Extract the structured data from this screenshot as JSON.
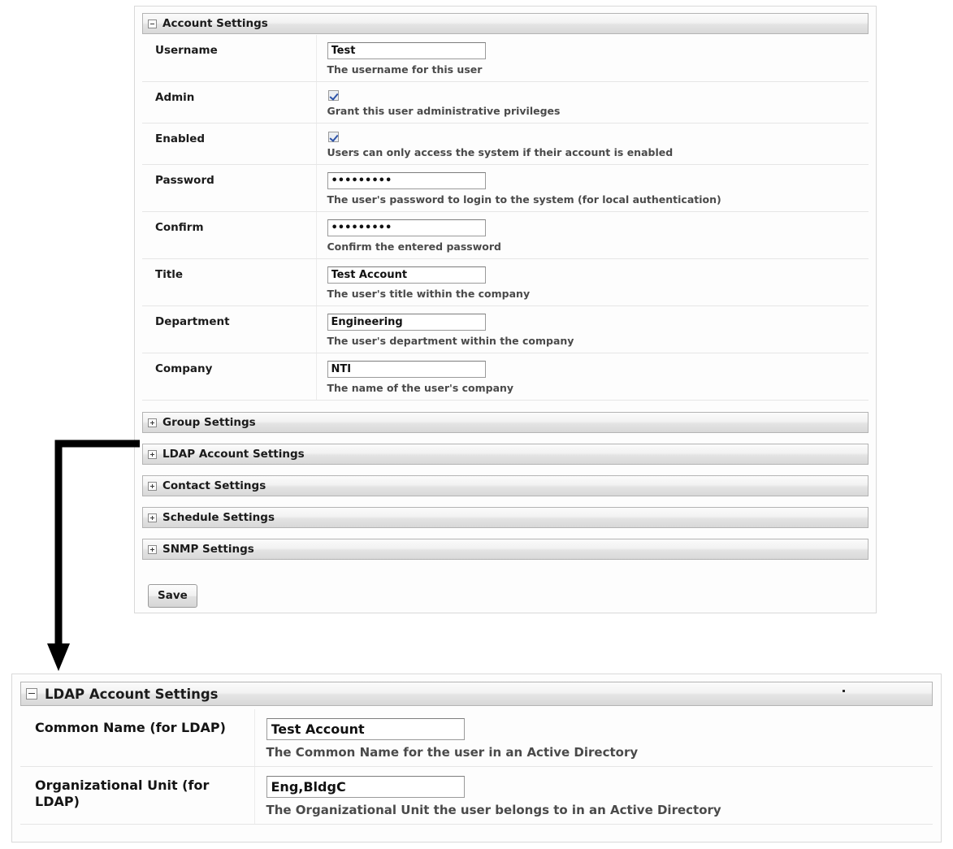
{
  "top_form": {
    "section": {
      "title": "Account Settings",
      "toggle_icon": "minus-box-icon",
      "expanded": true
    },
    "fields": [
      {
        "label": "Username",
        "type": "text",
        "value": "Test",
        "hint": "The username for this user"
      },
      {
        "label": "Admin",
        "type": "checkbox",
        "checked": true,
        "hint": "Grant this user administrative privileges"
      },
      {
        "label": "Enabled",
        "type": "checkbox",
        "checked": true,
        "hint": "Users can only access the system if their account is enabled"
      },
      {
        "label": "Password",
        "type": "password",
        "value": "•••••••••",
        "hint": "The user's password to login to the system (for local authentication)"
      },
      {
        "label": "Confirm",
        "type": "password",
        "value": "•••••••••",
        "hint": "Confirm the entered password"
      },
      {
        "label": "Title",
        "type": "text",
        "value": "Test Account",
        "hint": "The user's title within the company"
      },
      {
        "label": "Department",
        "type": "text",
        "value": "Engineering",
        "hint": "The user's department within the company"
      },
      {
        "label": "Company",
        "type": "text",
        "value": "NTI",
        "hint": "The name of the user's company"
      }
    ],
    "collapsed_sections": [
      {
        "title": "Group Settings",
        "toggle_icon": "plus-box-icon"
      },
      {
        "title": "LDAP Account Settings",
        "toggle_icon": "plus-box-icon"
      },
      {
        "title": "Contact Settings",
        "toggle_icon": "plus-box-icon"
      },
      {
        "title": "Schedule Settings",
        "toggle_icon": "plus-box-icon"
      },
      {
        "title": "SNMP Settings",
        "toggle_icon": "plus-box-icon"
      }
    ],
    "save_label": "Save"
  },
  "ldap_panel": {
    "section": {
      "title": "LDAP Account Settings",
      "toggle_icon": "minus-box-icon",
      "expanded": true
    },
    "fields": [
      {
        "label": "Common Name (for LDAP)",
        "type": "text",
        "value": "Test Account",
        "hint": "The Common Name for the user in an Active Directory"
      },
      {
        "label": "Organizational Unit (for LDAP)",
        "type": "text",
        "value": "Eng,BldgC",
        "hint": "The Organizational Unit the user belongs to in an Active Directory"
      }
    ]
  },
  "annotation": {
    "arrow_icon": "callout-arrow-icon",
    "description": "Arrow pointing from the LDAP Account Settings collapsed header down to the expanded LDAP Account Settings panel"
  },
  "colors": {
    "panel_border": "#d9d9d9",
    "header_border": "#b4b4b4",
    "text": "#1b1b1b",
    "hint_text": "#4a4a4a",
    "checkbox_check": "#2d53a8",
    "arrow": "#000000"
  }
}
